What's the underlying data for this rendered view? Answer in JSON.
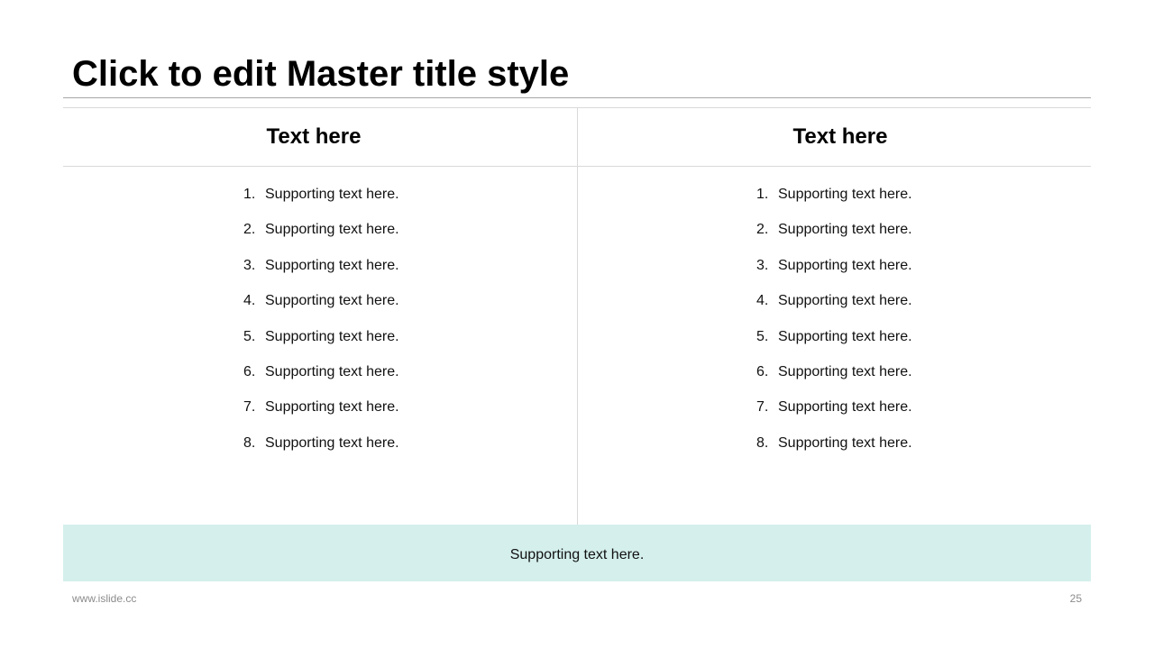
{
  "title": "Click to edit Master title style",
  "columns": [
    {
      "header": "Text here",
      "items": [
        {
          "num": "1.",
          "text": "Supporting text here."
        },
        {
          "num": "2.",
          "text": "Supporting text here."
        },
        {
          "num": "3.",
          "text": "Supporting text here."
        },
        {
          "num": "4.",
          "text": "Supporting text here."
        },
        {
          "num": "5.",
          "text": "Supporting text here."
        },
        {
          "num": "6.",
          "text": "Supporting text here."
        },
        {
          "num": "7.",
          "text": "Supporting text here."
        },
        {
          "num": "8.",
          "text": "Supporting text here."
        }
      ]
    },
    {
      "header": "Text here",
      "items": [
        {
          "num": "1.",
          "text": "Supporting text here."
        },
        {
          "num": "2.",
          "text": "Supporting text here."
        },
        {
          "num": "3.",
          "text": "Supporting text here."
        },
        {
          "num": "4.",
          "text": "Supporting text here."
        },
        {
          "num": "5.",
          "text": "Supporting text here."
        },
        {
          "num": "6.",
          "text": "Supporting text here."
        },
        {
          "num": "7.",
          "text": "Supporting text here."
        },
        {
          "num": "8.",
          "text": "Supporting text here."
        }
      ]
    }
  ],
  "footer_band_text": "Supporting text here.",
  "site": "www.islide.cc",
  "page_number": "25",
  "colors": {
    "band": "#d4efec",
    "rule": "#a6a6a6"
  }
}
